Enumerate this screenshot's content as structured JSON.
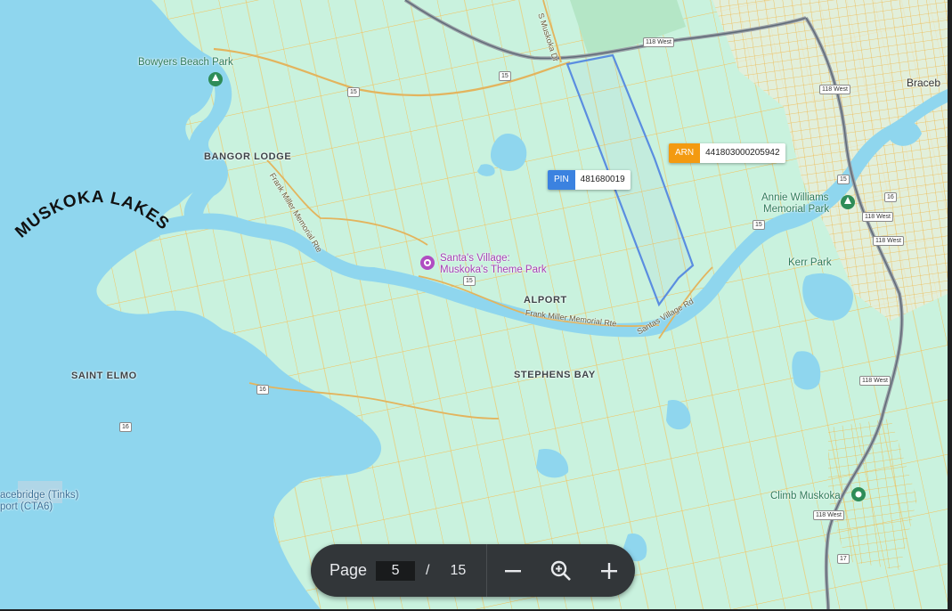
{
  "map": {
    "lake_title": "MUSKOKA LAKES",
    "places": {
      "bowyers": "Bowyers Beach Park",
      "bangor": "BANGOR LODGE",
      "alport": "ALPORT",
      "stephens": "STEPHENS BAY",
      "saint_elmo": "SAINT ELMO",
      "kerr": "Kerr Park",
      "annie_1": "Annie Williams",
      "annie_2": "Memorial Park",
      "climb": "Climb Muskoka",
      "santa_1": "Santa's Village:",
      "santa_2": "Muskoka's Theme Park",
      "airport_1": "acebridge (Tinks)",
      "airport_2": "port (CTA6)",
      "town": "Braceb"
    },
    "roads": {
      "frank_miller_1": "Frank Miller Memorial Rte",
      "frank_miller_2": "Frank Miller Memorial Rte",
      "santas_village_rd": "Santas Village Rd",
      "muskoka_dr": "S Muskoka Dr"
    },
    "shields": {
      "r118_top": "118 West",
      "r118_a": "118 West",
      "r118_b": "118 West",
      "r118_c": "118 West",
      "r118_d": "118 West",
      "r118_e": "118 West",
      "r15_a": "15",
      "r15_b": "15",
      "r15_c": "15",
      "r15_d": "15",
      "r15_e": "15",
      "r16": "16",
      "r16b": "16",
      "r16c": "16",
      "r17": "17"
    },
    "tags": {
      "pin_key": "PIN",
      "pin_value": "481680019",
      "arn_key": "ARN",
      "arn_value": "441803000205942"
    },
    "colors": {
      "land": "#c9f2de",
      "water": "#8fd6ee",
      "parcel_lines": "#f3c15a",
      "parcel_outline": "#5a8de0",
      "pin_tag": "#3b82e0",
      "arn_tag": "#f39a11",
      "highway": "#9aa0a6"
    }
  },
  "pager": {
    "label": "Page",
    "current_page": "5",
    "separator": "/",
    "total_pages": "15"
  }
}
